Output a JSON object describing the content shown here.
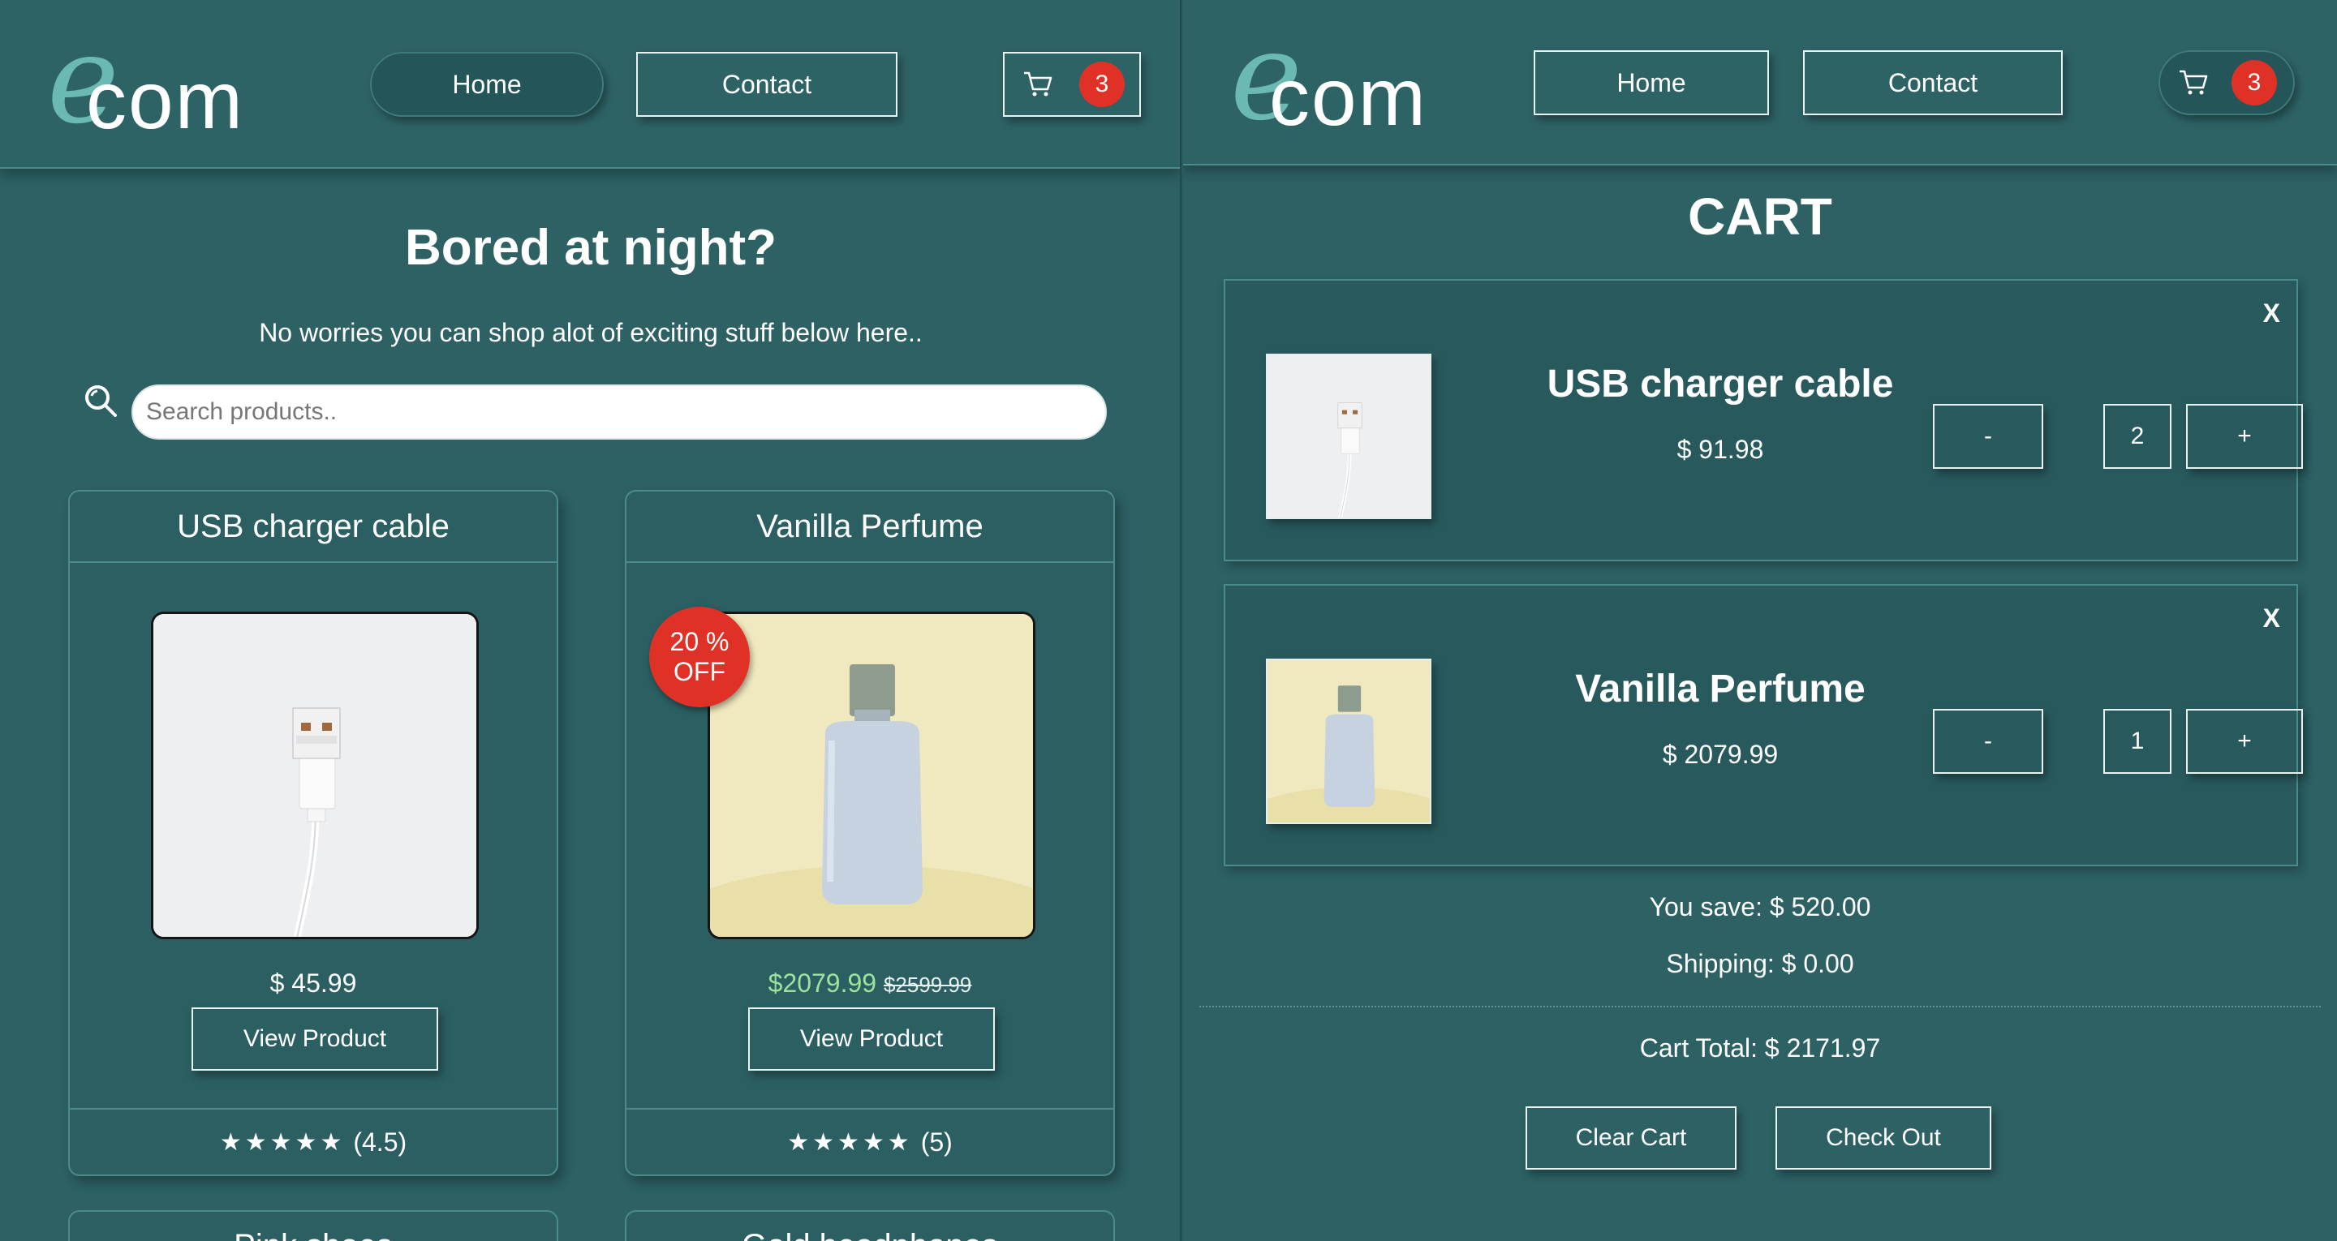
{
  "brand": {
    "logo_e": "e",
    "logo_com": "com"
  },
  "nav": {
    "home": "Home",
    "contact": "Contact",
    "cart_count": "3"
  },
  "icons": {
    "cart": "cart-icon",
    "search": "search-icon",
    "star": "star-icon"
  },
  "colors": {
    "background": "#2d6164",
    "badge": "#e03127",
    "sale_price": "#9ce39c",
    "logo_accent": "#6bbab2"
  },
  "shop": {
    "title": "Bored at night?",
    "subtitle": "No worries you can shop alot of exciting stuff below here..",
    "search_placeholder": "Search products..",
    "products": [
      {
        "name": "USB charger cable",
        "price": "$ 45.99",
        "button": "View Product",
        "stars": "★★★★★",
        "rating": "(4.5)"
      },
      {
        "name": "Vanilla Perfume",
        "discount_line1": "20 %",
        "discount_line2": "OFF",
        "sale_price": "$2079.99",
        "old_price": "$2599.99",
        "button": "View Product",
        "stars": "★★★★★",
        "rating": "(5)"
      }
    ],
    "more_products": [
      "Pink shoes",
      "Gold headphones"
    ]
  },
  "cart": {
    "title": "CART",
    "items": [
      {
        "name": "USB charger cable",
        "price": "$ 91.98",
        "quantity": "2",
        "remove": "X",
        "minus": "-",
        "plus": "+"
      },
      {
        "name": "Vanilla Perfume",
        "price": "$ 2079.99",
        "quantity": "1",
        "remove": "X",
        "minus": "-",
        "plus": "+"
      }
    ],
    "you_save": "You save: $ 520.00",
    "shipping": "Shipping: $ 0.00",
    "total": "Cart Total: $ 2171.97",
    "clear": "Clear Cart",
    "checkout": "Check Out"
  }
}
